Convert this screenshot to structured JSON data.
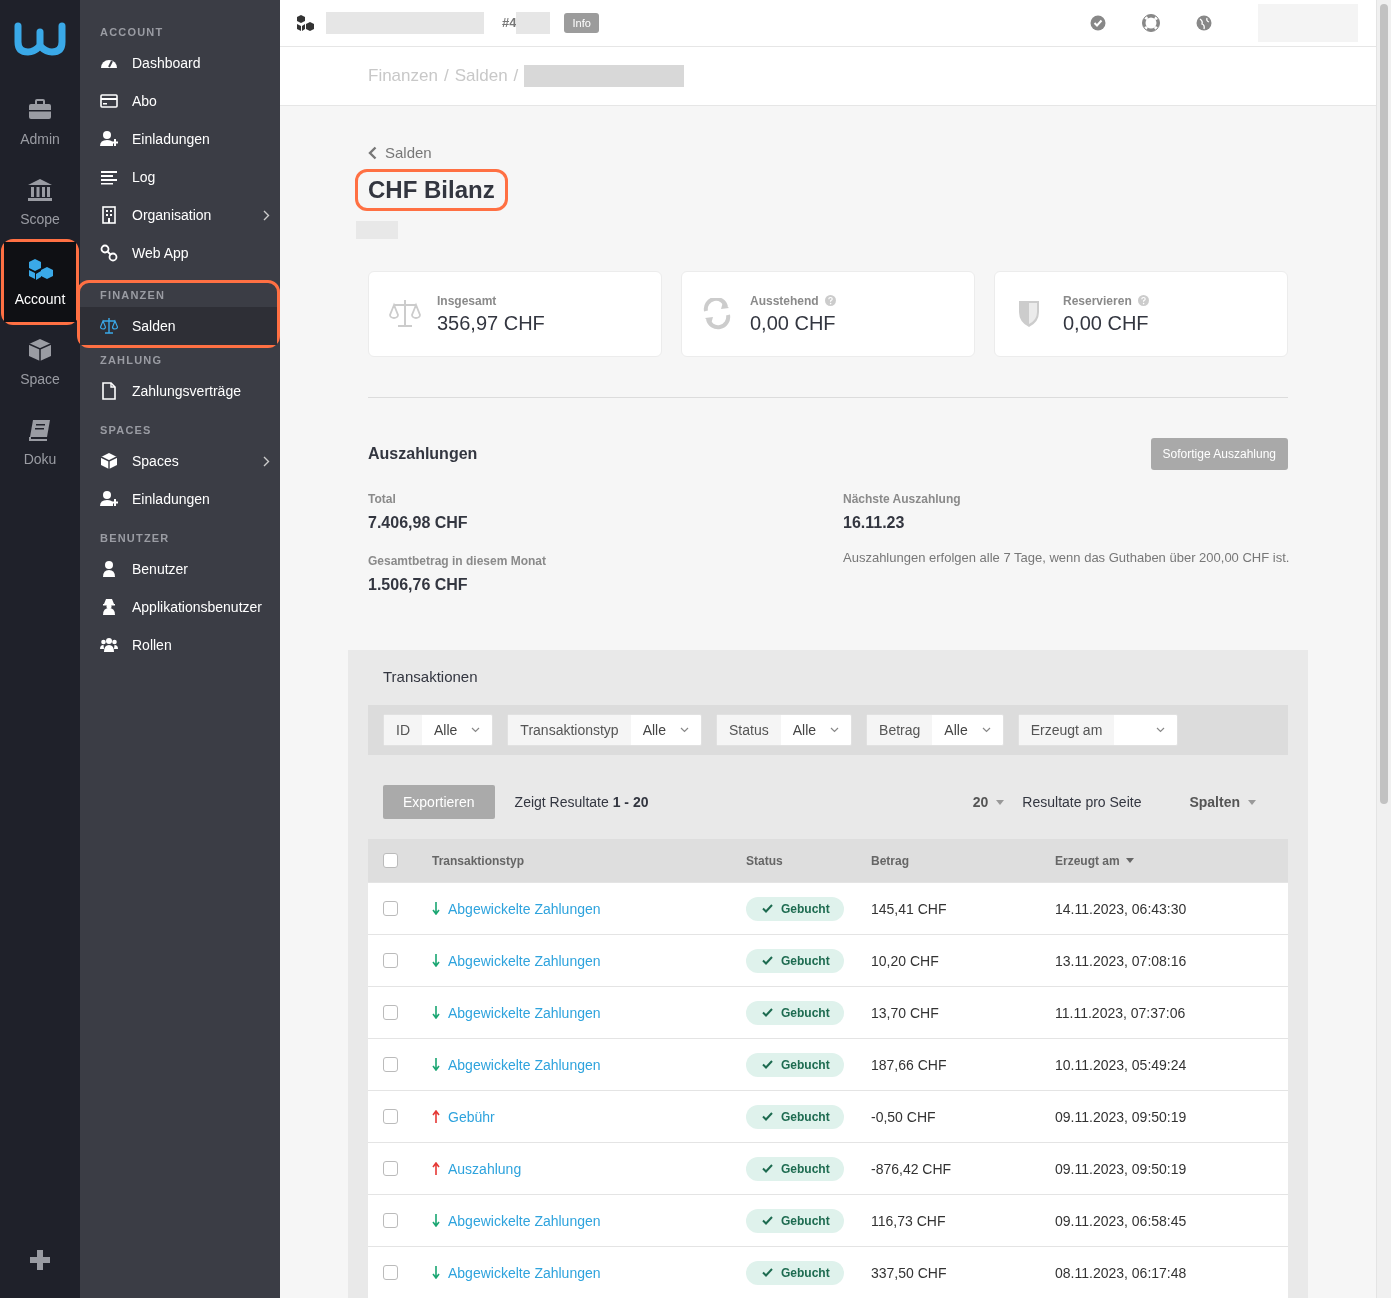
{
  "rail": {
    "items": [
      {
        "label": "Admin",
        "selected": false,
        "highlighted": false
      },
      {
        "label": "Scope",
        "selected": false,
        "highlighted": false
      },
      {
        "label": "Account",
        "selected": true,
        "highlighted": true
      },
      {
        "label": "Space",
        "selected": false,
        "highlighted": false
      },
      {
        "label": "Doku",
        "selected": false,
        "highlighted": false
      }
    ]
  },
  "sidebar": {
    "sections": [
      {
        "title": "ACCOUNT",
        "highlighted": false,
        "items": [
          {
            "label": "Dashboard",
            "selected": false,
            "submenu": false
          },
          {
            "label": "Abo",
            "selected": false,
            "submenu": false
          },
          {
            "label": "Einladungen",
            "selected": false,
            "submenu": false
          },
          {
            "label": "Log",
            "selected": false,
            "submenu": false
          },
          {
            "label": "Organisation",
            "selected": false,
            "submenu": true
          },
          {
            "label": "Web App",
            "selected": false,
            "submenu": false
          }
        ]
      },
      {
        "title": "FINANZEN",
        "highlighted": true,
        "items": [
          {
            "label": "Salden",
            "selected": true,
            "submenu": false
          }
        ]
      },
      {
        "title": "ZAHLUNG",
        "highlighted": false,
        "items": [
          {
            "label": "Zahlungsverträge",
            "selected": false,
            "submenu": false
          }
        ]
      },
      {
        "title": "SPACES",
        "highlighted": false,
        "items": [
          {
            "label": "Spaces",
            "selected": false,
            "submenu": true
          },
          {
            "label": "Einladungen",
            "selected": false,
            "submenu": false
          }
        ]
      },
      {
        "title": "BENUTZER",
        "highlighted": false,
        "items": [
          {
            "label": "Benutzer",
            "selected": false,
            "submenu": false
          },
          {
            "label": "Applikationsbenutzer",
            "selected": false,
            "submenu": false
          },
          {
            "label": "Rollen",
            "selected": false,
            "submenu": false
          }
        ]
      }
    ]
  },
  "top_bar": {
    "space_id": "#4",
    "badge": "Info"
  },
  "breadcrumb": {
    "separator": "/",
    "items": [
      "Finanzen",
      "Salden"
    ]
  },
  "back_link": "Salden",
  "title": {
    "text": "CHF Bilanz",
    "highlighted": true
  },
  "cards": [
    {
      "label": "Insgesamt",
      "value": "356,97 CHF",
      "help": false
    },
    {
      "label": "Ausstehend",
      "value": "0,00 CHF",
      "help": true
    },
    {
      "label": "Reservieren",
      "value": "0,00 CHF",
      "help": true
    }
  ],
  "payouts": {
    "title": "Auszahlungen",
    "button": "Sofortige Auszahlung",
    "stats": [
      {
        "label": "Total",
        "value": "7.406,98 CHF"
      },
      {
        "label": "Gesamtbetrag in diesem Monat",
        "value": "1.506,76 CHF"
      }
    ],
    "next": {
      "label": "Nächste Auszahlung",
      "value": "16.11.23",
      "note": "Auszahlungen erfolgen alle 7 Tage, wenn das Guthaben über 200,00 CHF ist."
    }
  },
  "transactions": {
    "title": "Transaktionen",
    "filters": [
      {
        "label": "ID",
        "value": "Alle"
      },
      {
        "label": "Transaktionstyp",
        "value": "Alle"
      },
      {
        "label": "Status",
        "value": "Alle"
      },
      {
        "label": "Betrag",
        "value": "Alle"
      },
      {
        "label": "Erzeugt am"
      }
    ],
    "export_button": "Exportieren",
    "results": "Zeigt Resultate **1 - 20**",
    "page_size": "20",
    "page_size_label": "Resultate pro Seite",
    "columns_button": "Spalten",
    "table": {
      "select_all_checked": false,
      "columns": [
        "Transaktionstyp",
        "Status",
        "Betrag",
        "Erzeugt am"
      ],
      "rows": [
        {
          "checked": false,
          "kind": "in",
          "type": "Abgewickelte Zahlungen",
          "status": "Gebucht",
          "amount": "145,41 CHF",
          "created": "14.11.2023, 06:43:30"
        },
        {
          "checked": false,
          "kind": "in",
          "type": "Abgewickelte Zahlungen",
          "status": "Gebucht",
          "amount": "10,20 CHF",
          "created": "13.11.2023, 07:08:16"
        },
        {
          "checked": false,
          "kind": "in",
          "type": "Abgewickelte Zahlungen",
          "status": "Gebucht",
          "amount": "13,70 CHF",
          "created": "11.11.2023, 07:37:06"
        },
        {
          "checked": false,
          "kind": "in",
          "type": "Abgewickelte Zahlungen",
          "status": "Gebucht",
          "amount": "187,66 CHF",
          "created": "10.11.2023, 05:49:24"
        },
        {
          "checked": false,
          "kind": "out",
          "type": "Gebühr",
          "status": "Gebucht",
          "amount": "-0,50 CHF",
          "created": "09.11.2023, 09:50:19"
        },
        {
          "checked": false,
          "kind": "out",
          "type": "Auszahlung",
          "status": "Gebucht",
          "amount": "-876,42 CHF",
          "created": "09.11.2023, 09:50:19"
        },
        {
          "checked": false,
          "kind": "in",
          "type": "Abgewickelte Zahlungen",
          "status": "Gebucht",
          "amount": "116,73 CHF",
          "created": "09.11.2023, 06:58:45"
        },
        {
          "checked": false,
          "kind": "in",
          "type": "Abgewickelte Zahlungen",
          "status": "Gebucht",
          "amount": "337,50 CHF",
          "created": "08.11.2023, 06:17:48"
        }
      ]
    }
  }
}
